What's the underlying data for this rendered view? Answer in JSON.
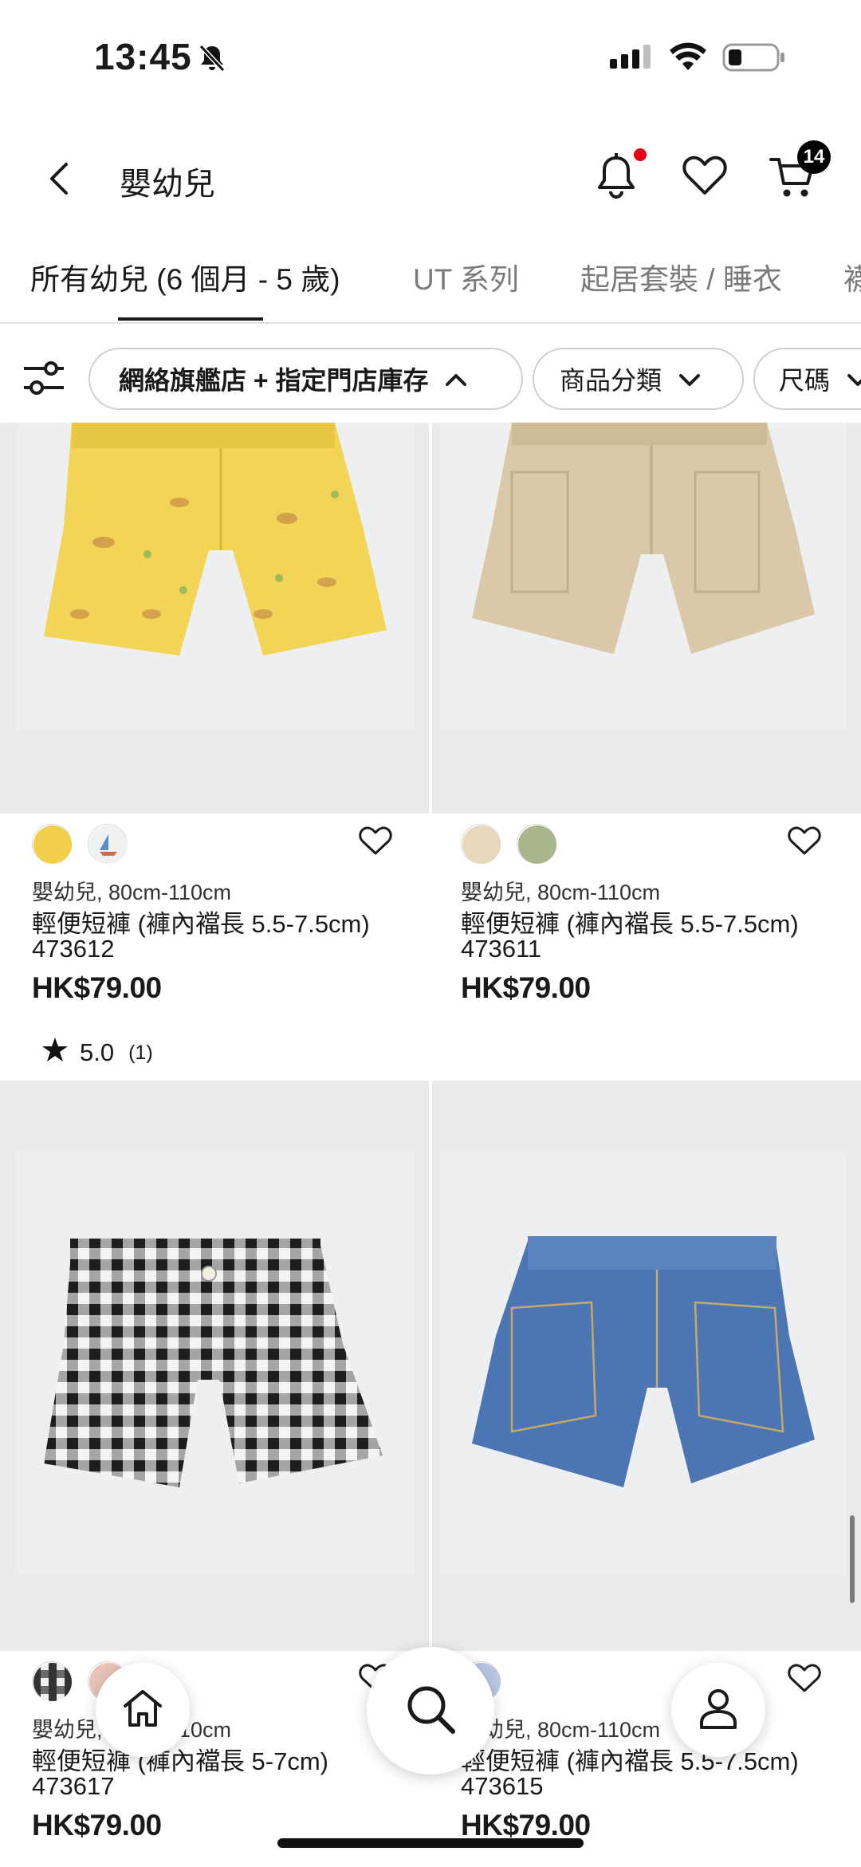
{
  "status_bar": {
    "time": "13:45"
  },
  "header": {
    "title": "嬰幼兒",
    "cart_count": "14"
  },
  "tabs": [
    {
      "label": "所有幼兒 (6 個月 - 5 歲)"
    },
    {
      "label": "UT 系列"
    },
    {
      "label": "起居套裝 / 睡衣"
    },
    {
      "label": "襪"
    }
  ],
  "filters": {
    "chips": [
      {
        "label": "網絡旗艦店 + 指定門店庫存"
      },
      {
        "label": "商品分類"
      },
      {
        "label": "尺碼"
      }
    ]
  },
  "products": [
    {
      "category": "嬰幼兒, 80cm-110cm",
      "name": "輕便短褲 (褲內襠長 5.5-7.5cm)",
      "code": "473612",
      "price": "HK$79.00",
      "swatches": [
        "#f2cf4a",
        "#eef0f2"
      ],
      "rating": "5.0",
      "rating_count": "(1)"
    },
    {
      "category": "嬰幼兒, 80cm-110cm",
      "name": "輕便短褲 (褲內襠長 5.5-7.5cm)",
      "code": "473611",
      "price": "HK$79.00",
      "swatches": [
        "#e6d7bd",
        "#a8b58d"
      ]
    },
    {
      "category": "嬰幼兒, 80cm-110cm",
      "name": "輕便短褲 (褲內襠長 5-7cm)",
      "code": "473617",
      "price": "HK$79.00",
      "swatches": [
        "#3a3a3a",
        "#e9c2b8"
      ]
    },
    {
      "category": "嬰幼兒, 80cm-110cm",
      "name": "輕便短褲 (褲內襠長 5.5-7.5cm)",
      "code": "473615",
      "price": "HK$79.00",
      "swatches": [
        "#b9c6e2"
      ]
    }
  ]
}
